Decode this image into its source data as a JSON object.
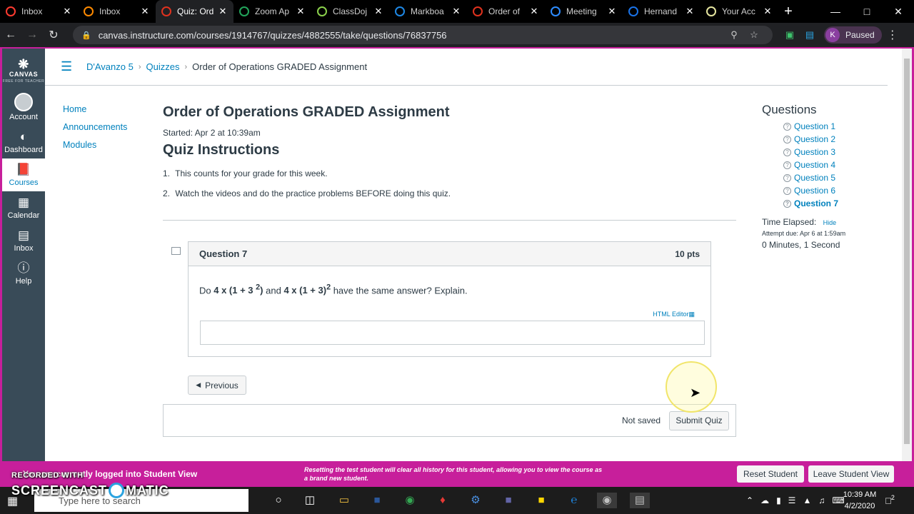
{
  "browser": {
    "tabs": [
      {
        "label": "Inbox",
        "icon": "loading-ring-icon",
        "color": "#ff3b30",
        "active": false
      },
      {
        "label": "Inbox",
        "icon": "loading-ring-icon",
        "color": "#ff8a00",
        "active": false
      },
      {
        "label": "Quiz: Ord",
        "icon": "canvas-icon",
        "color": "#e0321e",
        "active": true
      },
      {
        "label": "Zoom Ap",
        "icon": "sheets-icon",
        "color": "#22a55b",
        "active": false
      },
      {
        "label": "ClassDoj",
        "icon": "classdojo-icon",
        "color": "#8bd14c",
        "active": false
      },
      {
        "label": "Markboa",
        "icon": "markboard-icon",
        "color": "#1e88e5",
        "active": false
      },
      {
        "label": "Order of",
        "icon": "canvas-icon",
        "color": "#e0321e",
        "active": false
      },
      {
        "label": "Meeting",
        "icon": "zoom-icon",
        "color": "#2d8cff",
        "active": false
      },
      {
        "label": "Hernand",
        "icon": "calendar-icon",
        "color": "#1a73e8",
        "active": false
      },
      {
        "label": "Your Acc",
        "icon": "account-icon",
        "color": "#e6e6a0",
        "active": false
      }
    ],
    "url": "canvas.instructure.com/courses/1914767/quizzes/4882555/take/questions/76837756",
    "profile_initial": "K",
    "profile_status": "Paused"
  },
  "globalnav": {
    "logo": "CANVAS",
    "logo_sub": "FREE FOR TEACHER",
    "items": [
      {
        "label": "Account",
        "icon": "account-icon"
      },
      {
        "label": "Dashboard",
        "icon": "dashboard-icon"
      },
      {
        "label": "Courses",
        "icon": "courses-icon"
      },
      {
        "label": "Calendar",
        "icon": "calendar-icon"
      },
      {
        "label": "Inbox",
        "icon": "inbox-icon"
      },
      {
        "label": "Help",
        "icon": "help-icon"
      }
    ]
  },
  "breadcrumb": {
    "course": "D'Avanzo 5",
    "section": "Quizzes",
    "current": "Order of Operations GRADED Assignment"
  },
  "coursenav": {
    "items": [
      "Home",
      "Announcements",
      "Modules"
    ]
  },
  "quiz": {
    "title": "Order of Operations GRADED Assignment",
    "started": "Started: Apr 2 at 10:39am",
    "instructions_title": "Quiz Instructions",
    "instructions": [
      {
        "num": "1.",
        "text": "This counts for your grade for this week."
      },
      {
        "num": "2.",
        "text": "Watch the videos and do the practice problems BEFORE doing this quiz."
      }
    ],
    "question": {
      "title": "Question 7",
      "points": "10 pts",
      "text_prefix": "Do ",
      "expr1_base": "4 x (1 + 3 ",
      "expr1_sup": "2",
      "expr1_close": ")",
      "mid": " and ",
      "expr2_base": "4 x (1 + 3)",
      "expr2_sup": "2",
      "suffix": " have the same answer? Explain.",
      "html_editor": "HTML Editor"
    },
    "previous_label": "Previous",
    "not_saved": "Not saved",
    "submit_label": "Submit Quiz"
  },
  "sidebar": {
    "title": "Questions",
    "questions": [
      "Question 1",
      "Question 2",
      "Question 3",
      "Question 4",
      "Question 5",
      "Question 6",
      "Question 7"
    ],
    "time_elapsed_label": "Time Elapsed:",
    "hide_label": "Hide",
    "attempt_due": "Attempt due: Apr 6 at 1:59am",
    "elapsed_value": "0 Minutes, 1 Second"
  },
  "studentbar": {
    "text": "You are currently logged into Student View",
    "warning": "Resetting the test student will clear all history for this student, allowing you to view the course as a brand new student.",
    "reset_label": "Reset Student",
    "leave_label": "Leave Student View"
  },
  "taskbar": {
    "search_placeholder": "Type here to search",
    "time": "10:39 AM",
    "date": "4/2/2020",
    "notification_count": "2"
  },
  "watermark": {
    "line1": "RECORDED WITH",
    "brand_left": "SCREENCAST",
    "brand_right": "MATIC"
  },
  "colors": {
    "accent": "#0081bd",
    "nav_bg": "#394b58",
    "student_view": "#c71f9b"
  }
}
